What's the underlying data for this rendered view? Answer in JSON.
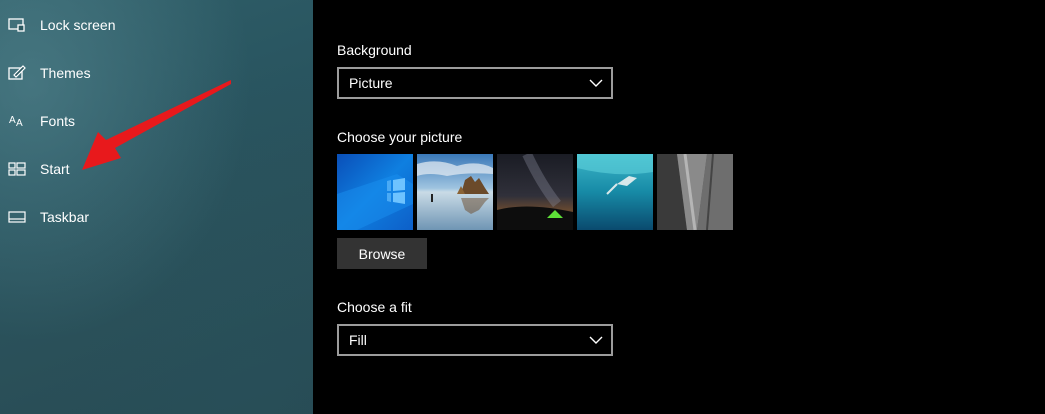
{
  "sidebar": {
    "items": [
      {
        "label": "Lock screen",
        "icon": "lock-screen-icon"
      },
      {
        "label": "Themes",
        "icon": "themes-icon"
      },
      {
        "label": "Fonts",
        "icon": "fonts-icon"
      },
      {
        "label": "Start",
        "icon": "start-icon"
      },
      {
        "label": "Taskbar",
        "icon": "taskbar-icon"
      }
    ]
  },
  "background": {
    "label": "Background",
    "value": "Picture"
  },
  "picture": {
    "label": "Choose your picture",
    "thumbnails": [
      {
        "name": "windows-light"
      },
      {
        "name": "beach-rocks"
      },
      {
        "name": "night-sky-tent"
      },
      {
        "name": "underwater-swimmer"
      },
      {
        "name": "rock-cliff"
      }
    ],
    "browse_label": "Browse"
  },
  "fit": {
    "label": "Choose a fit",
    "value": "Fill"
  },
  "colors": {
    "arrow": "#e8191c",
    "sidebar_bg": "#2b5860",
    "content_bg": "#000000",
    "button_bg": "#333333"
  }
}
